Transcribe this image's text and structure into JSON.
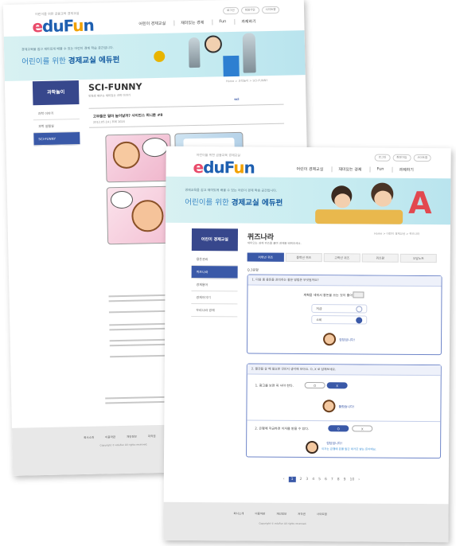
{
  "common": {
    "logo": "eduFun",
    "tagline": "어린이를 위한 금융교육 경제교실",
    "top_buttons": [
      "로그인",
      "회원가입",
      "사이트맵"
    ],
    "gnb": [
      "어린이 경제교실",
      "재미있는 경제",
      "Fun",
      "과제하기"
    ],
    "banner_sub": "경제교육을 쉽고 재미있게 배울 수 있는 어린이 경제 학습 공간입니다.",
    "banner_main_plain": "어린이를 위한 ",
    "banner_main_bold": "경제교실 에듀펀",
    "footer_links": [
      "회사소개",
      "이용약관",
      "개인정보",
      "저작권",
      "사이트맵"
    ],
    "footer_copy": "Copyright © eduFun All rights reserved."
  },
  "back_page": {
    "sidebar_title": "과학놀이",
    "sidebar_items": [
      "과학 이야기",
      "과학 실험실",
      "SCI-FUNNY"
    ],
    "active_item": 2,
    "page_title": "SCI-FUNNY",
    "page_desc": "만화로 배우는 재미있는 과학 이야기",
    "breadcrumb": "Home > 과학놀이 > SCI-FUNNY",
    "article_title": "고무줄은 얼마 늘어날까? 사이언스 퍼니툰 #8",
    "article_meta": "2012.05.14 | 조회 1024"
  },
  "front_page": {
    "sidebar_title": "어린이 경제교실",
    "sidebar_items": [
      "용돈관리",
      "퀴즈나라",
      "경제용어",
      "경제이야기",
      "우리나라 경제"
    ],
    "active_item": 1,
    "page_title": "퀴즈나라",
    "page_desc": "재미있는 경제 퀴즈를 풀며 경제를 배워보세요.",
    "breadcrumb": "Home > 어린이 경제교실 > 퀴즈나라",
    "tabs": [
      "저학년 퀴즈",
      "중학년 퀴즈",
      "고학년 퀴즈",
      "퀴즈왕",
      "오답노트"
    ],
    "active_tab": 0,
    "quiz_label": "Q.3문항",
    "q1": {
      "head": "1. 다음 중 용돈을 관리하는 좋은 방법은 무엇일까요?",
      "prompt": "계획을 세워서 용돈을 쓰는 것이 좋아요.",
      "options": [
        "저금",
        "소비"
      ],
      "selected": 1,
      "result": "정답입니다!"
    },
    "q2": {
      "head": "2. 물건을 살 때 필요한 것인지 생각해 보아요. O, X 로 답해보세요.",
      "prompt": "1. 광고를 보면 꼭 사야 한다.",
      "o_label": "O",
      "x_label": "X",
      "result": "틀렸습니다!"
    },
    "q3": {
      "prompt": "2. 은행에 저금하면 이자를 받을 수 있다.",
      "o_label": "O",
      "x_label": "X",
      "result": "정답입니다!",
      "hint": "이자는 은행에 돈을 맡긴 대가로 받는 돈이에요."
    },
    "pages": [
      "‹",
      "1",
      "2",
      "3",
      "4",
      "5",
      "6",
      "7",
      "8",
      "9",
      "10",
      "›"
    ],
    "active_page": 1
  },
  "colors": {
    "brand_blue": "#1e5fb0",
    "nav_active": "#3a59a8",
    "sidebar_head": "#37478c",
    "banner_bg": "#c7ecf1"
  }
}
